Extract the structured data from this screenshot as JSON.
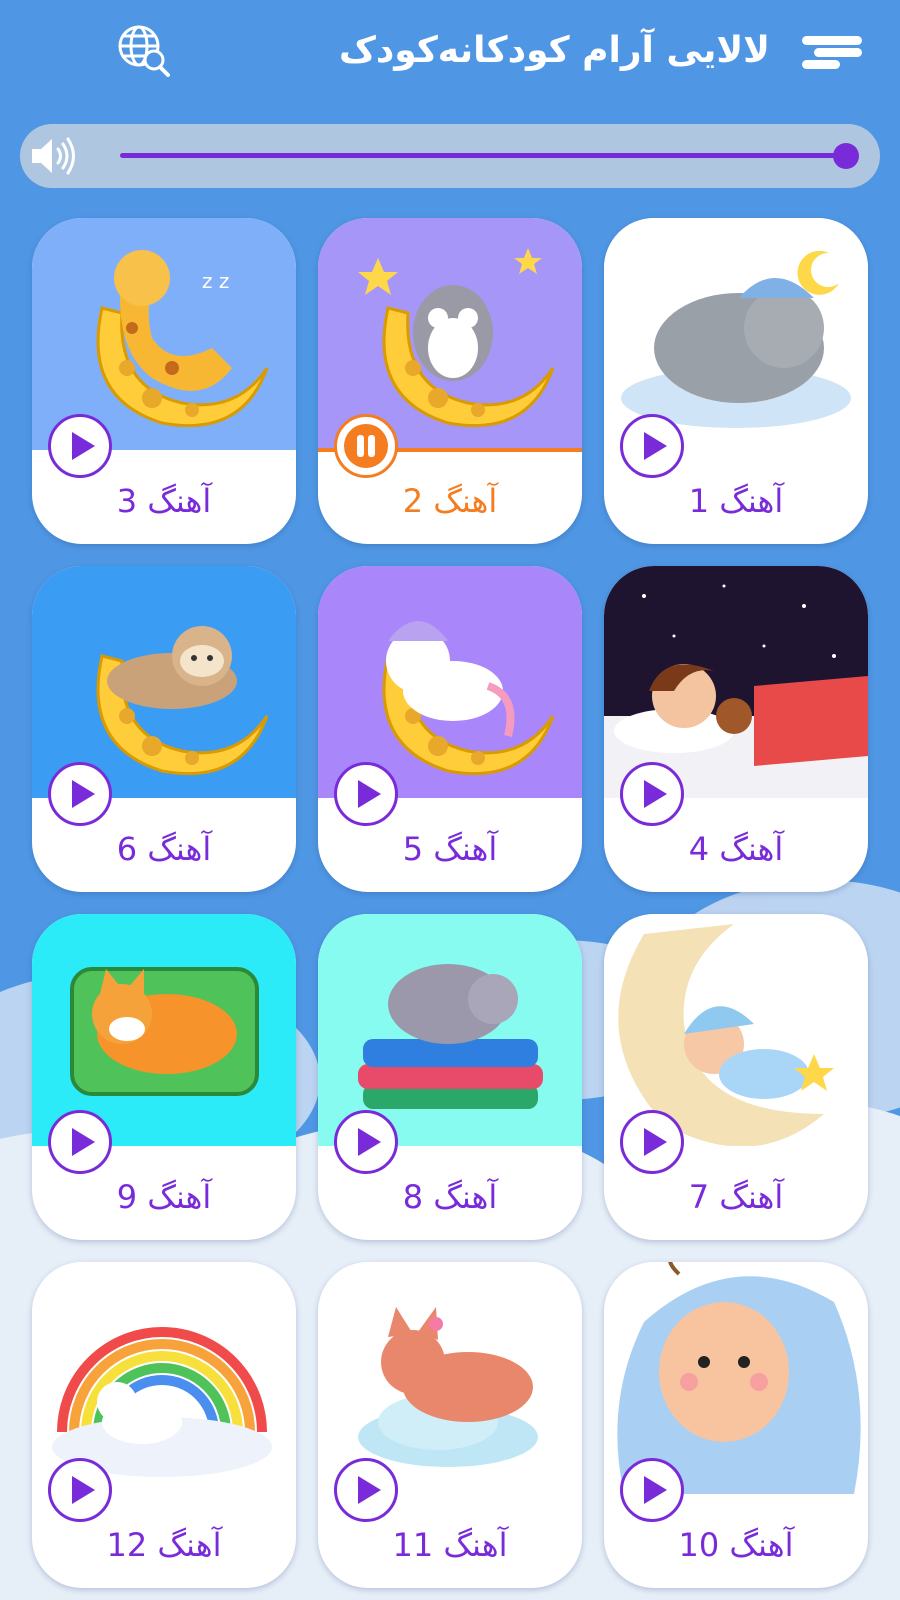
{
  "app": {
    "title": "لالایی آرام کودکانه‌کودک",
    "menu_icon": "hamburger-menu-icon",
    "language_icon": "globe-search-icon"
  },
  "colors": {
    "background": "#4f97e4",
    "accent": "#7a2bd9",
    "active": "#f57c1f",
    "volume_track": "#afc6e1"
  },
  "volume": {
    "icon": "speaker-icon",
    "level": 1.0
  },
  "songs": [
    {
      "label": "آهنگ 1",
      "state": "play",
      "art": "elephant-on-cloud-with-moon",
      "art_bg": "#ffffff"
    },
    {
      "label": "آهنگ 2",
      "state": "pause",
      "art": "owl-on-moon-with-stars",
      "art_bg": "#a696f7"
    },
    {
      "label": "آهنگ 3",
      "state": "play",
      "art": "giraffe-on-moon",
      "art_bg": "#80aff9"
    },
    {
      "label": "آهنگ 4",
      "state": "play",
      "art": "girl-sleeping-with-teddy",
      "art_bg": "#1e1430"
    },
    {
      "label": "آهنگ 5",
      "state": "play",
      "art": "unicorn-on-moon",
      "art_bg": "#a987fb"
    },
    {
      "label": "آهنگ 6",
      "state": "play",
      "art": "sloth-on-moon",
      "art_bg": "#3b9cf3"
    },
    {
      "label": "آهنگ 7",
      "state": "play",
      "art": "baby-on-moon",
      "art_bg": "#ffffff"
    },
    {
      "label": "آهنگ 8",
      "state": "play",
      "art": "cat-on-pillows",
      "art_bg": "#88fbf0"
    },
    {
      "label": "آهنگ 9",
      "state": "play",
      "art": "cat-on-pillow",
      "art_bg": "#2cebf9"
    },
    {
      "label": "آهنگ 10",
      "state": "play",
      "art": "baby-under-blanket",
      "art_bg": "#ffffff"
    },
    {
      "label": "آهنگ 11",
      "state": "play",
      "art": "fox-on-cloud",
      "art_bg": "#ffffff"
    },
    {
      "label": "آهنگ 12",
      "state": "play",
      "art": "unicorn-under-rainbow",
      "art_bg": "#ffffff"
    }
  ]
}
